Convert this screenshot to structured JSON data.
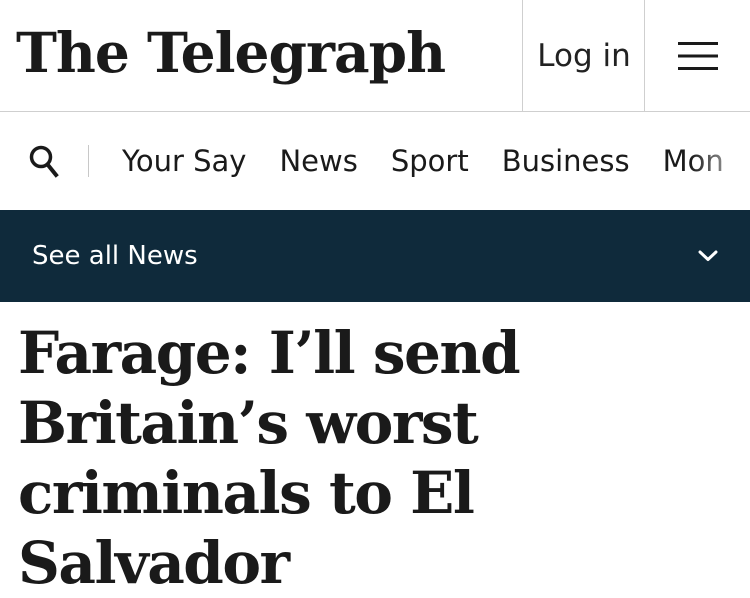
{
  "header": {
    "logo_text": "The Telegraph",
    "login_label": "Log in",
    "menu_icon": "hamburger-icon"
  },
  "nav": {
    "search_icon": "search-icon",
    "items": [
      {
        "label": "Your Say"
      },
      {
        "label": "News"
      },
      {
        "label": "Sport"
      },
      {
        "label": "Business"
      },
      {
        "label": "Mon"
      }
    ]
  },
  "section_bar": {
    "label": "See all News",
    "icon": "chevron-down-icon",
    "background": "#0f2a3b"
  },
  "article": {
    "headline": "Farage: I’ll send Britain’s worst criminals to El Salvador"
  }
}
